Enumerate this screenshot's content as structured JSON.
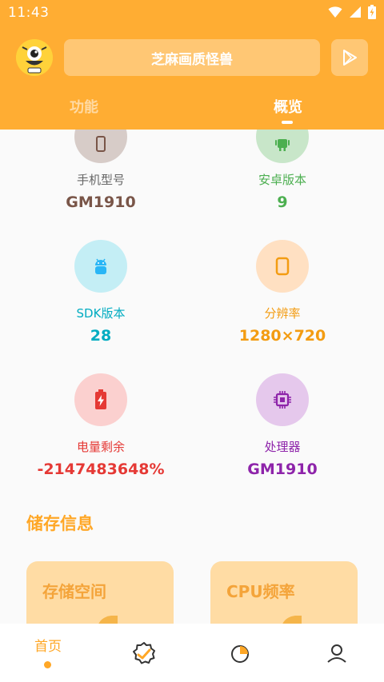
{
  "status_bar": {
    "time": "11:43"
  },
  "header": {
    "title": "芝麻画质怪兽",
    "tabs": [
      {
        "label": "功能"
      },
      {
        "label": "概览"
      }
    ]
  },
  "device_info": [
    {
      "label": "手机型号",
      "value": "GM1910",
      "icon": "phone-icon",
      "label_color": "#666666",
      "value_color": "#795548",
      "circle_color": "#d7ccc8"
    },
    {
      "label": "安卓版本",
      "value": "9",
      "icon": "android-icon",
      "label_color": "#4caf50",
      "value_color": "#4caf50",
      "circle_color": "#c8e6c9"
    },
    {
      "label": "SDK版本",
      "value": "28",
      "icon": "android-icon",
      "label_color": "#00acc1",
      "value_color": "#00acc1",
      "circle_color": "#c4eef5"
    },
    {
      "label": "分辨率",
      "value": "1280×720",
      "icon": "screen-icon",
      "label_color": "#f39c12",
      "value_color": "#f39c12",
      "circle_color": "#ffe0c2"
    },
    {
      "label": "电量剩余",
      "value": "-2147483648%",
      "icon": "battery-icon",
      "label_color": "#e53935",
      "value_color": "#e53935",
      "circle_color": "#fbd0cf"
    },
    {
      "label": "处理器",
      "value": "GM1910",
      "icon": "chip-icon",
      "label_color": "#8e24aa",
      "value_color": "#8e24aa",
      "circle_color": "#e5c8ec"
    }
  ],
  "storage": {
    "section_title": "储存信息",
    "cards": [
      {
        "title": "存储空间"
      },
      {
        "title": "CPU频率"
      }
    ]
  },
  "bottom_nav": {
    "home_label": "首页",
    "icons": [
      "home-label",
      "verified-icon",
      "pie-chart-icon",
      "person-icon"
    ]
  },
  "colors": {
    "accent": "#ffad33",
    "section": "#ffa726",
    "card": "#ffdca4"
  }
}
